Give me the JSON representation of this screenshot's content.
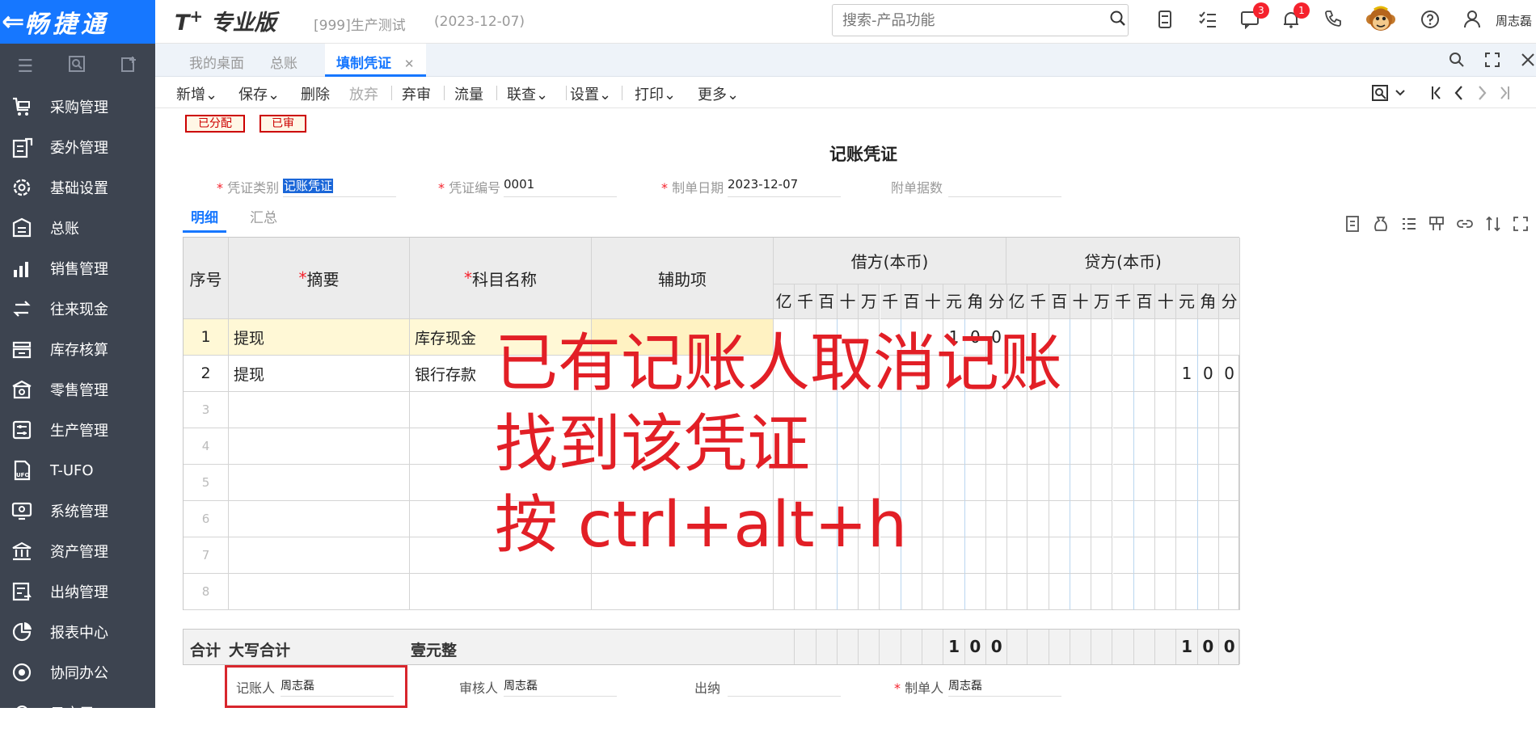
{
  "brand": {
    "arrow": "⇐",
    "name": "畅捷通"
  },
  "sidebar": {
    "items": [
      {
        "label": "采购管理",
        "icon": "cart-icon"
      },
      {
        "label": "委外管理",
        "icon": "outsource-icon"
      },
      {
        "label": "基础设置",
        "icon": "settings-gear-icon"
      },
      {
        "label": "总账",
        "icon": "ledger-icon"
      },
      {
        "label": "销售管理",
        "icon": "sales-chart-icon"
      },
      {
        "label": "往来现金",
        "icon": "transfer-icon"
      },
      {
        "label": "库存核算",
        "icon": "inventory-icon"
      },
      {
        "label": "零售管理",
        "icon": "retail-icon"
      },
      {
        "label": "生产管理",
        "icon": "production-icon"
      },
      {
        "label": "T-UFO",
        "icon": "ufo-icon"
      },
      {
        "label": "系统管理",
        "icon": "system-icon"
      },
      {
        "label": "资产管理",
        "icon": "bank-icon"
      },
      {
        "label": "出纳管理",
        "icon": "cashier-icon"
      },
      {
        "label": "报表中心",
        "icon": "pie-report-icon"
      },
      {
        "label": "协同办公",
        "icon": "collab-icon"
      },
      {
        "label": "云应用",
        "icon": "cloud-icon"
      }
    ]
  },
  "header": {
    "product_prefix": "T",
    "product_plus": "+",
    "product_name": "专业版",
    "account": "[999]生产测试",
    "date": "(2023-12-07)",
    "search_placeholder": "搜索-产品功能",
    "badge_messages": "3",
    "badge_notifications": "1",
    "user": "周志磊"
  },
  "tabs": {
    "desk": "我的桌面",
    "ledger": "总账",
    "active": "填制凭证",
    "close": "✕"
  },
  "toolbar": {
    "new": "新增",
    "save": "保存",
    "delete": "删除",
    "discard": "放弃",
    "review": "弃审",
    "flow": "流量",
    "link": "联查",
    "settings": "设置",
    "print": "打印",
    "more": "更多"
  },
  "stamps": {
    "assigned": "已分配",
    "audited": "已审"
  },
  "voucher": {
    "title": "记账凭证",
    "type_label": "凭证类别",
    "type_value": "记账凭证",
    "no_label": "凭证编号",
    "no_value": "0001",
    "date_label": "制单日期",
    "date_value": "2023-12-07",
    "attach_label": "附单据数",
    "subtab_detail": "明细",
    "subtab_summary": "汇总"
  },
  "grid": {
    "headers": {
      "seq": "序号",
      "summary": "摘要",
      "subject": "科目名称",
      "aux": "辅助项",
      "debit": "借方(本币)",
      "credit": "贷方(本币)"
    },
    "digits": [
      "亿",
      "千",
      "百",
      "十",
      "万",
      "千",
      "百",
      "十",
      "元",
      "角",
      "分"
    ],
    "rows": [
      {
        "seq": "1",
        "summary": "提现",
        "subject": "库存现金",
        "debit": "100",
        "credit": ""
      },
      {
        "seq": "2",
        "summary": "提现",
        "subject": "银行存款",
        "debit": "",
        "credit": "100"
      },
      {
        "seq": "3",
        "summary": "",
        "subject": "",
        "debit": "",
        "credit": ""
      },
      {
        "seq": "4",
        "summary": "",
        "subject": "",
        "debit": "",
        "credit": ""
      },
      {
        "seq": "5",
        "summary": "",
        "subject": "",
        "debit": "",
        "credit": ""
      },
      {
        "seq": "6",
        "summary": "",
        "subject": "",
        "debit": "",
        "credit": ""
      },
      {
        "seq": "7",
        "summary": "",
        "subject": "",
        "debit": "",
        "credit": ""
      },
      {
        "seq": "8",
        "summary": "",
        "subject": "",
        "debit": "",
        "credit": ""
      }
    ]
  },
  "total": {
    "label": "合计",
    "caps_label": "大写合计",
    "caps_value": "壹元整",
    "debit": "100",
    "credit": "100"
  },
  "footer": {
    "bookkeeper_label": "记账人",
    "bookkeeper": "周志磊",
    "auditor_label": "审核人",
    "auditor": "周志磊",
    "cashier_label": "出纳",
    "maker_label": "制单人",
    "maker": "周志磊"
  },
  "annotation": {
    "line1": "已有记账人取消记账",
    "line2": "找到该凭证",
    "line3": "按 ctrl+alt+h"
  },
  "colors": {
    "brand_blue": "#1677ff",
    "sidebar": "#3d4450",
    "annotation_red": "#e21f26"
  }
}
